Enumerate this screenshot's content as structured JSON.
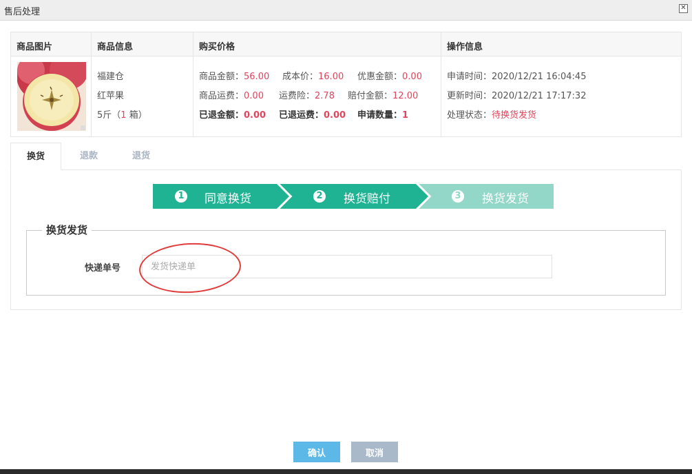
{
  "window": {
    "title": "售后处理",
    "close_glyph": "✕"
  },
  "table": {
    "headers": [
      "商品图片",
      "商品信息",
      "购买价格",
      "操作信息"
    ],
    "product": {
      "image_icon": "apple-product-image",
      "origin": "福建仓",
      "name": "红苹果",
      "spec_prefix": "5斤（",
      "spec_qty": "1",
      "spec_suffix": " 箱）"
    },
    "price": {
      "goods_amount_label": "商品金额：",
      "goods_amount": "56.00",
      "cost_label": "成本价：",
      "cost": "16.00",
      "discount_label": "优惠金额：",
      "discount": "0.00",
      "shipping_label": "商品运费：",
      "shipping": "0.00",
      "shipping_ins_label": "运费险：",
      "shipping_ins": "2.78",
      "compensation_label": "赔付金额：",
      "compensation": "12.00",
      "refunded_label": "已退金额：",
      "refunded": "0.00",
      "refunded_ship_label": "已退运费：",
      "refunded_ship": "0.00",
      "apply_qty_label": "申请数量：",
      "apply_qty": "1"
    },
    "operation": {
      "apply_time_label": "申请时间：",
      "apply_time": "2020/12/21 16:04:45",
      "update_time_label": "更新时间：",
      "update_time": "2020/12/21 17:17:32",
      "status_label": "处理状态：",
      "status": "待换货发货"
    }
  },
  "tabs": [
    "换货",
    "退款",
    "退货"
  ],
  "steps": [
    {
      "num": "1",
      "label": "同意换货"
    },
    {
      "num": "2",
      "label": "换货赔付"
    },
    {
      "num": "3",
      "label": "换货发货"
    }
  ],
  "colors": {
    "step_active": "#1fb394",
    "step_pending": "#93d7c8",
    "accent_red": "#e0455c",
    "ok_button": "#5cb8e6",
    "cancel_button": "#a9b9c9"
  },
  "form": {
    "legend": "换货发货",
    "tracking_label": "快递单号",
    "tracking_placeholder": "发货快递单",
    "tracking_value": ""
  },
  "buttons": {
    "confirm": "确认",
    "cancel": "取消"
  }
}
